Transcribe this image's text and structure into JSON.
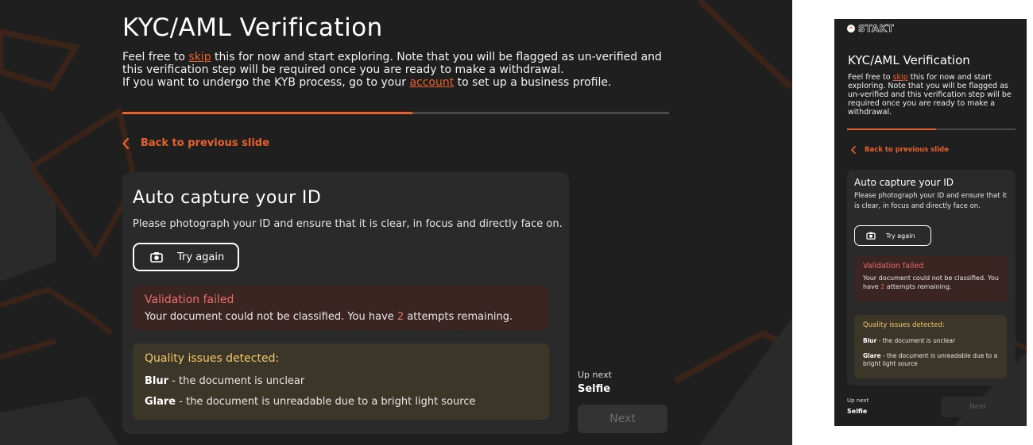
{
  "colors": {
    "background": "#1f1f1f",
    "card": "#2a2a2a",
    "accent": "#e8612c",
    "error_text": "#ec6d68",
    "error_bg": "#3a2523",
    "warning_text": "#f3c96b",
    "warning_bg": "#3b3627"
  },
  "progress": {
    "fraction": 0.53
  },
  "header": {
    "title": "KYC/AML Verification",
    "intro_prefix": "Feel free to ",
    "skip_link": "skip",
    "intro_middle": " this for now and start exploring. Note that you will be flagged as un-verified and this verification step will be required once you are ready to make a withdrawal.",
    "intro_kyb_prefix": "If you want to undergo the KYB process, go to your ",
    "account_link": "account",
    "intro_kyb_suffix": " to set up a business profile."
  },
  "nav": {
    "back_label": "Back to previous slide",
    "back_icon": "chevron-left-icon"
  },
  "capture": {
    "title": "Auto capture your ID",
    "description": "Please photograph your ID and ensure that it is clear, in focus and directly face on.",
    "try_again_label": "Try again",
    "camera_icon": "camera-icon"
  },
  "validation": {
    "title": "Validation failed",
    "message_prefix": "Your document could not be classified. You have ",
    "attempts": "2",
    "message_suffix": " attempts remaining."
  },
  "quality": {
    "title": "Quality issues detected:",
    "issues": [
      {
        "name": "Blur",
        "desc": " - the document is unclear"
      },
      {
        "name": "Glare",
        "desc": " - the document is unreadable due to a bright light source"
      }
    ]
  },
  "footer": {
    "up_next_label": "Up next",
    "up_next_value": "Selfie",
    "next_label": "Next"
  },
  "mobile": {
    "logo_text": "STAKT",
    "intro": "Feel free to skip this for now and start exploring. Note that you will be flagged as un-verified and this verification step will be required once you are ready to make a withdrawal."
  }
}
